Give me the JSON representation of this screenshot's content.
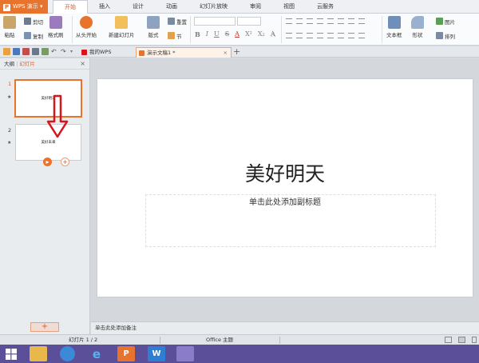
{
  "app": {
    "logo_label": "WPS 演示",
    "logo_letter": "P",
    "menu_tabs": [
      "开始",
      "插入",
      "设计",
      "动画",
      "幻灯片放映",
      "审阅",
      "视图",
      "云服务"
    ]
  },
  "ribbon": {
    "paste": "粘贴",
    "cut": "剪切",
    "copy": "复制",
    "format_painter": "格式刷",
    "from_start": "从头开始",
    "new_slide": "新建幻灯片",
    "layout": "版式",
    "reset": "重置",
    "section": "节",
    "format_glyphs": [
      "B",
      "I",
      "U",
      "S",
      "A",
      "X²",
      "X₂",
      "A"
    ],
    "textbox": "文本框",
    "shape": "形状",
    "picture": "图片",
    "arrange": "排列"
  },
  "tabbar": {
    "tabs": [
      {
        "label": "我的WPS"
      },
      {
        "label": "演示文稿1 *"
      }
    ],
    "close_glyph": "×",
    "add_glyph": "+"
  },
  "left_pane": {
    "outline_tab": "大纲",
    "separator": "|",
    "slides_tab": "幻灯片",
    "close_glyph": "×",
    "slides": [
      {
        "number": "1",
        "star": "★",
        "title": "美好明天"
      },
      {
        "number": "2",
        "star": "★",
        "title": "美好未来"
      }
    ],
    "add_glyph": "+"
  },
  "slide": {
    "title": "美好明天",
    "subtitle_placeholder": "单击此处添加副标题"
  },
  "notes": {
    "placeholder": "单击此处添加备注"
  },
  "status": {
    "slide_info": "幻灯片 1 / 2",
    "theme": "Office 主题"
  },
  "colors": {
    "accent": "#e8732c",
    "annotation_arrow": "#d8141c",
    "taskbar": "#5b4f9a"
  }
}
